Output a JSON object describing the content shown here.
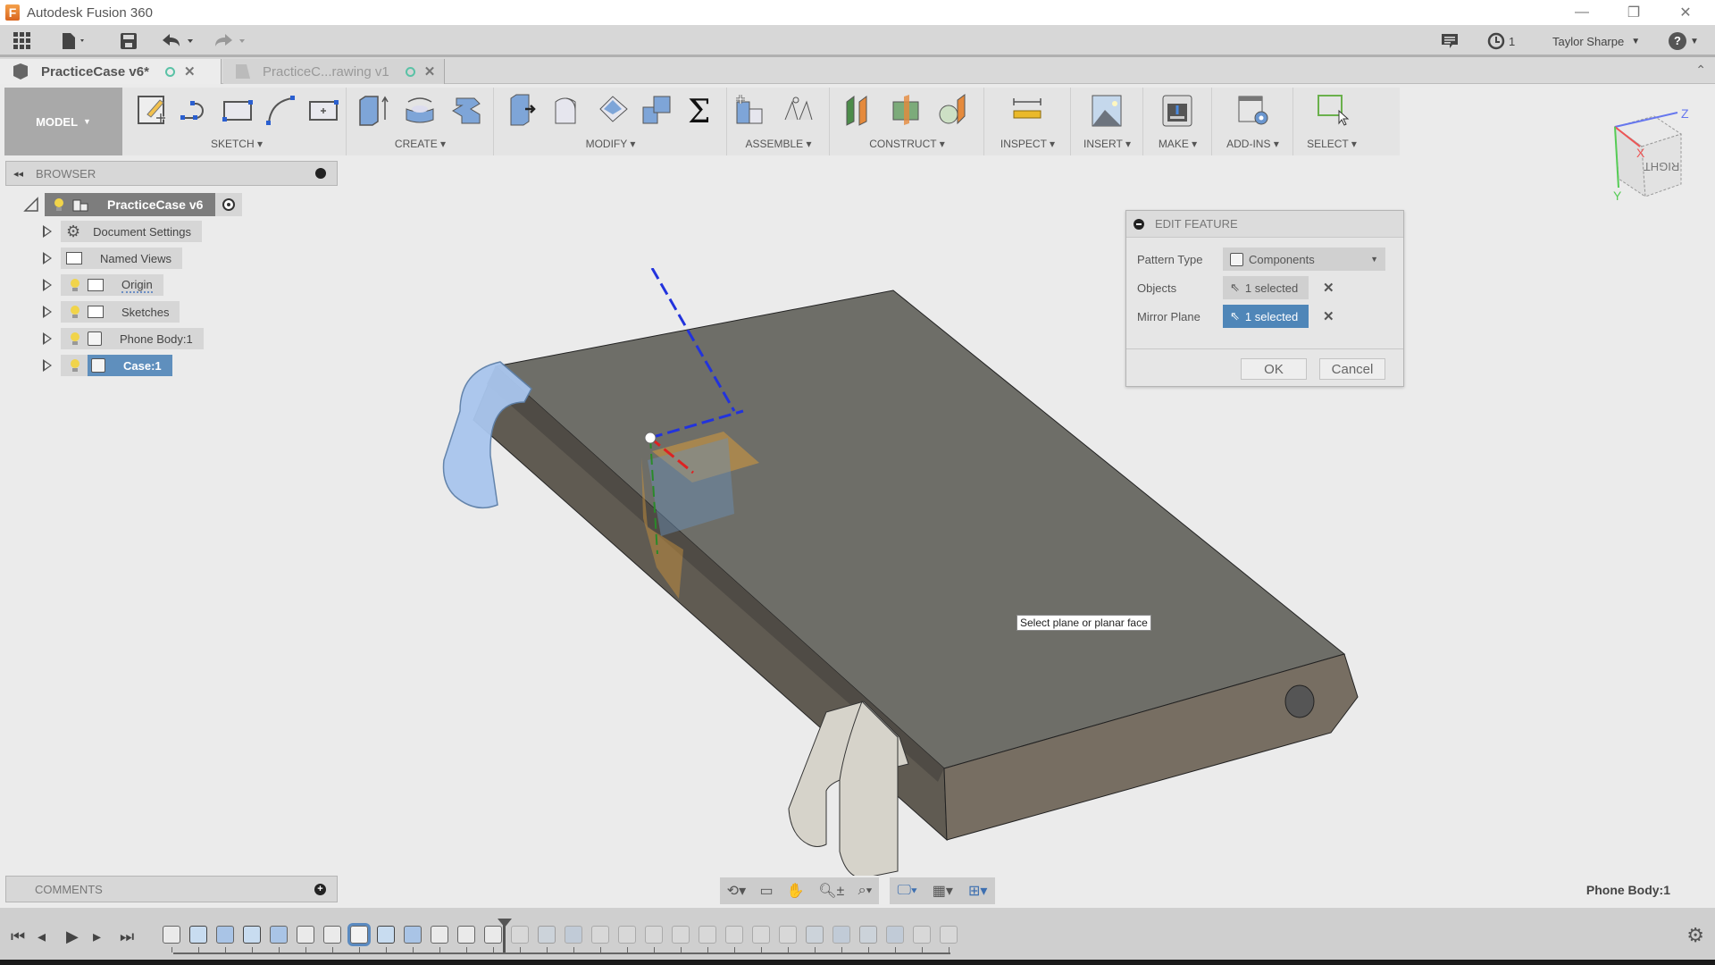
{
  "app": {
    "title": "Autodesk Fusion 360",
    "logo_letter": "F",
    "window_controls": {
      "minimize": "—",
      "restore": "❐",
      "close": "✕"
    }
  },
  "quick_toolbar": {
    "notifications_count": "1",
    "user_name": "Taylor Sharpe",
    "help_label": "?"
  },
  "tabs": [
    {
      "label": "PracticeCase v6*",
      "active": true
    },
    {
      "label": "PracticeC...rawing v1",
      "active": false
    }
  ],
  "ribbon": {
    "workspace": "MODEL",
    "groups": [
      {
        "label": "SKETCH",
        "icons": [
          "create-sketch-icon",
          "line-icon",
          "rectangle-icon",
          "arc-icon",
          "point-icon"
        ]
      },
      {
        "label": "CREATE",
        "icons": [
          "extrude-icon",
          "revolve-icon",
          "sweep-icon"
        ]
      },
      {
        "label": "MODIFY",
        "icons": [
          "press-pull-icon",
          "fillet-icon",
          "shell-icon",
          "combine-icon",
          "sigma-icon"
        ]
      },
      {
        "label": "ASSEMBLE",
        "icons": [
          "new-component-icon",
          "joint-icon"
        ]
      },
      {
        "label": "CONSTRUCT",
        "icons": [
          "offset-plane-icon",
          "midplane-icon",
          "tangent-plane-icon"
        ]
      },
      {
        "label": "INSPECT",
        "icons": [
          "measure-icon"
        ]
      },
      {
        "label": "INSERT",
        "icons": [
          "insert-image-icon"
        ]
      },
      {
        "label": "MAKE",
        "icons": [
          "3d-print-icon"
        ]
      },
      {
        "label": "ADD-INS",
        "icons": [
          "scripts-icon"
        ]
      },
      {
        "label": "SELECT",
        "icons": [
          "select-icon"
        ]
      }
    ]
  },
  "browser": {
    "title": "BROWSER",
    "root": "PracticeCase v6",
    "items": [
      {
        "label": "Document Settings",
        "icon": "gear-icon",
        "visible_toggle": false
      },
      {
        "label": "Named Views",
        "icon": "folder-icon",
        "visible_toggle": false
      },
      {
        "label": "Origin",
        "icon": "folder-icon",
        "visible_toggle": true
      },
      {
        "label": "Sketches",
        "icon": "folder-icon",
        "visible_toggle": true
      },
      {
        "label": "Phone Body:1",
        "icon": "component-icon",
        "visible_toggle": true
      },
      {
        "label": "Case:1",
        "icon": "component-icon",
        "visible_toggle": true,
        "selected": true
      }
    ]
  },
  "comments": {
    "title": "COMMENTS"
  },
  "dialog": {
    "title": "EDIT FEATURE",
    "pattern_type_label": "Pattern Type",
    "pattern_type_value": "Components",
    "objects_label": "Objects",
    "objects_value": "1 selected",
    "mirror_plane_label": "Mirror Plane",
    "mirror_plane_value": "1 selected",
    "ok": "OK",
    "cancel": "Cancel"
  },
  "viewport": {
    "tooltip": "Select plane or planar face",
    "viewcube_face": "RIGHT",
    "axes": {
      "x": "X",
      "y": "Y",
      "z": "Z"
    }
  },
  "status": {
    "selected_body": "Phone Body:1"
  },
  "timeline": {
    "controls": [
      "⏮",
      "◂",
      "▶",
      "▸",
      "⏭"
    ],
    "items": [
      {
        "type": "component",
        "state": "done"
      },
      {
        "type": "sketch",
        "state": "done"
      },
      {
        "type": "extrude",
        "state": "done"
      },
      {
        "type": "sketch",
        "state": "done"
      },
      {
        "type": "extrude",
        "state": "done"
      },
      {
        "type": "fillet",
        "state": "done"
      },
      {
        "type": "fillet",
        "state": "done"
      },
      {
        "type": "component",
        "state": "current"
      },
      {
        "type": "sketch",
        "state": "done"
      },
      {
        "type": "extrude",
        "state": "done"
      },
      {
        "type": "fillet",
        "state": "done"
      },
      {
        "type": "combine",
        "state": "done"
      },
      {
        "type": "mirror",
        "state": "done"
      },
      {
        "type": "mirror",
        "state": "future"
      },
      {
        "type": "sketch",
        "state": "future"
      },
      {
        "type": "extrude",
        "state": "future"
      },
      {
        "type": "joint",
        "state": "future"
      },
      {
        "type": "mirror",
        "state": "future"
      },
      {
        "type": "component",
        "state": "future"
      },
      {
        "type": "combine",
        "state": "future"
      },
      {
        "type": "fillet",
        "state": "future"
      },
      {
        "type": "fillet",
        "state": "future"
      },
      {
        "type": "fillet",
        "state": "future"
      },
      {
        "type": "fillet",
        "state": "future"
      },
      {
        "type": "sketch",
        "state": "future"
      },
      {
        "type": "extrude",
        "state": "future"
      },
      {
        "type": "sketch",
        "state": "future"
      },
      {
        "type": "extrude",
        "state": "future"
      },
      {
        "type": "fillet",
        "state": "future"
      },
      {
        "type": "fillet",
        "state": "future"
      }
    ]
  }
}
